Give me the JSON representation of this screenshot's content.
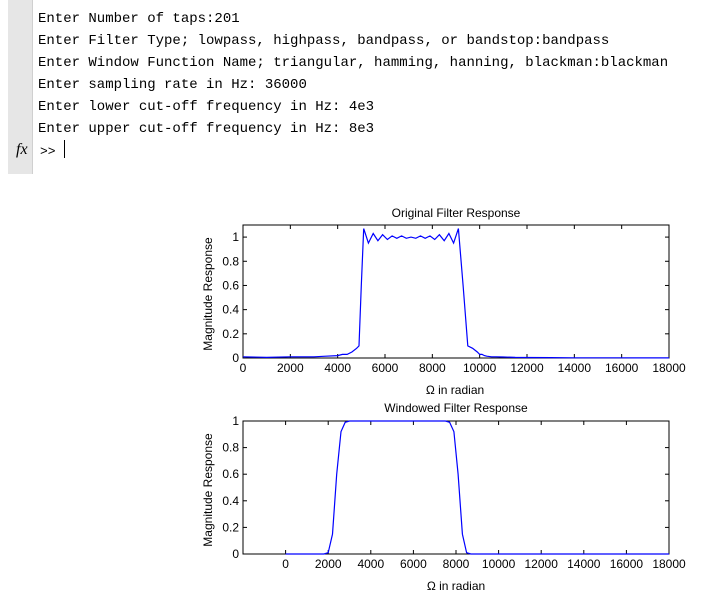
{
  "console": {
    "lines": [
      "Enter Number of taps:201",
      "Enter Filter Type; lowpass, highpass, bandpass, or bandstop:bandpass",
      "Enter Window Function Name; triangular, hamming, hanning, blackman:blackman",
      "Enter sampling rate in Hz: 36000",
      "Enter lower cut-off frequency in Hz: 4e3",
      "Enter upper cut-off frequency in Hz: 8e3"
    ],
    "fx_label": "fx",
    "prompt": ">>"
  },
  "chart_data": [
    {
      "type": "line",
      "title": "Original Filter Response",
      "xlabel": "Ω in radian",
      "ylabel": "Magnitude Response",
      "xlim": [
        0,
        18000
      ],
      "ylim": [
        0,
        1.1
      ],
      "xticks": [
        0,
        2000,
        4000,
        6000,
        8000,
        10000,
        12000,
        14000,
        16000,
        18000
      ],
      "xtick_labels": [
        "0",
        "2000",
        "4000",
        "6000",
        "8000",
        "10000",
        "12000",
        "14000",
        "16000",
        "18000"
      ],
      "yticks": [
        0,
        0.2,
        0.4,
        0.6,
        0.8,
        1
      ],
      "ytick_labels": [
        "0",
        "0.2",
        "0.4",
        "0.6",
        "0.8",
        "1"
      ],
      "line_color": "#0000ff",
      "series": [
        {
          "x": [
            0,
            1000,
            2000,
            3000,
            3500,
            4000,
            4200,
            4400,
            4600,
            4800,
            4900,
            5000,
            5100,
            5300,
            5500,
            5700,
            5900,
            6100,
            6300,
            6500,
            6700,
            6900,
            7100,
            7300,
            7500,
            7700,
            7900,
            8100,
            8300,
            8500,
            8700,
            8900,
            9100,
            9300,
            9500,
            9700,
            9900,
            10000,
            10100,
            10200,
            10300,
            10500,
            10700,
            11000,
            11500,
            12000,
            13000,
            14000,
            15000,
            16000,
            17000,
            18000
          ],
          "y": [
            0.01,
            0.005,
            0.01,
            0.01,
            0.015,
            0.02,
            0.03,
            0.03,
            0.05,
            0.08,
            0.1,
            0.6,
            1.07,
            0.95,
            1.03,
            0.97,
            1.02,
            0.98,
            1.01,
            0.99,
            1.01,
            0.99,
            1.0,
            0.99,
            1.01,
            0.99,
            1.01,
            0.98,
            1.02,
            0.97,
            1.03,
            0.95,
            1.07,
            0.6,
            0.1,
            0.08,
            0.05,
            0.03,
            0.03,
            0.02,
            0.015,
            0.01,
            0.01,
            0.008,
            0.005,
            0.004,
            0.003,
            0.002,
            0.002,
            0.002,
            0.001,
            0.001
          ]
        }
      ]
    },
    {
      "type": "line",
      "title": "Windowed Filter Response",
      "xlabel": "Ω  in radian",
      "ylabel": "Magnitude Response",
      "xlim": [
        -2000,
        18000
      ],
      "ylim": [
        0,
        1
      ],
      "xticks": [
        0,
        2000,
        4000,
        6000,
        8000,
        10000,
        12000,
        14000,
        16000,
        18000
      ],
      "xtick_labels": [
        "0",
        "2000",
        "4000",
        "6000",
        "8000",
        "10000",
        "12000",
        "14000",
        "16000",
        "18000"
      ],
      "yticks": [
        0,
        0.2,
        0.4,
        0.6,
        0.8,
        1
      ],
      "ytick_labels": [
        "0",
        "0.2",
        "0.4",
        "0.6",
        "0.8",
        "1"
      ],
      "line_color": "#0000ff",
      "series": [
        {
          "x": [
            0,
            1000,
            1800,
            2000,
            2200,
            2400,
            2600,
            2800,
            3000,
            3200,
            4000,
            5000,
            6000,
            7000,
            7500,
            7700,
            7900,
            8100,
            8300,
            8500,
            8700,
            9000,
            10000,
            12000,
            14000,
            16000,
            18000
          ],
          "y": [
            0,
            0,
            0,
            0.01,
            0.15,
            0.6,
            0.92,
            0.99,
            1.0,
            1.0,
            1.0,
            1.0,
            1.0,
            1.0,
            1.0,
            0.99,
            0.92,
            0.6,
            0.15,
            0.01,
            0,
            0,
            0,
            0,
            0,
            0,
            0
          ]
        }
      ]
    }
  ]
}
